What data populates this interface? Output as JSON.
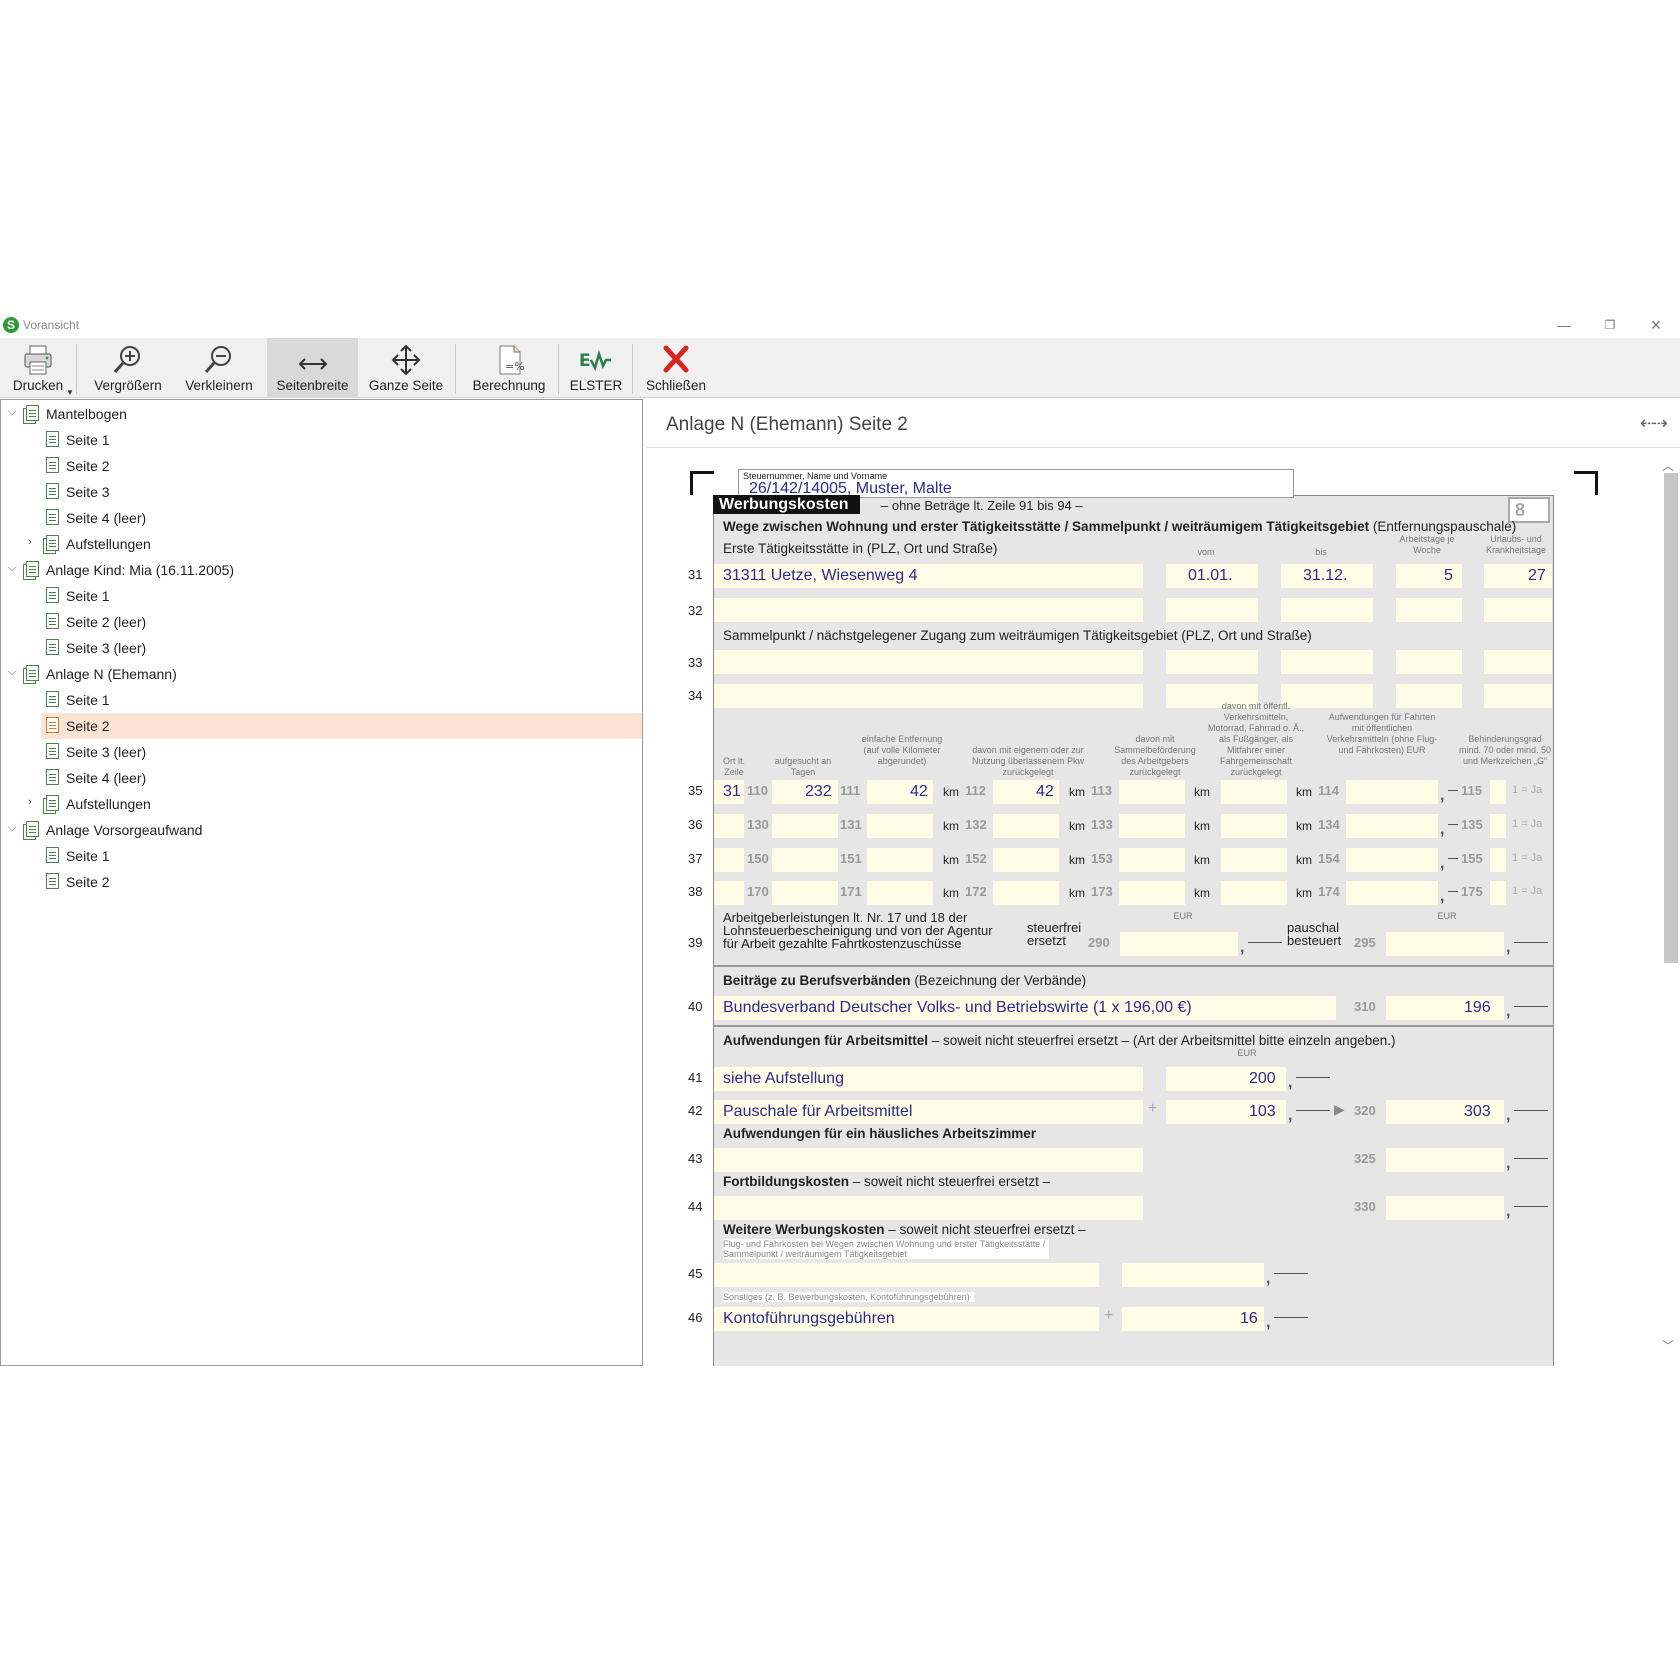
{
  "window": {
    "title": "Voransicht",
    "app_icon": "S"
  },
  "toolbar": {
    "print": "Drucken",
    "zoom_in": "Vergrößern",
    "zoom_out": "Verkleinern",
    "page_width": "Seitenbreite",
    "whole_page": "Ganze Seite",
    "calculation": "Berechnung",
    "elster": "ELSTER",
    "close": "Schließen"
  },
  "tree": {
    "mantelbogen": "Mantelbogen",
    "mb_s1": "Seite 1",
    "mb_s2": "Seite 2",
    "mb_s3": "Seite 3",
    "mb_s4": "Seite 4 (leer)",
    "mb_auf": "Aufstellungen",
    "kind": "Anlage Kind: Mia (16.11.2005)",
    "k_s1": "Seite 1",
    "k_s2": "Seite 2 (leer)",
    "k_s3": "Seite 3 (leer)",
    "anlage_n": "Anlage N (Ehemann)",
    "n_s1": "Seite 1",
    "n_s2": "Seite 2",
    "n_s3": "Seite 3 (leer)",
    "n_s4": "Seite 4 (leer)",
    "n_auf": "Aufstellungen",
    "vorsorge": "Anlage Vorsorgeaufwand",
    "v_s1": "Seite 1",
    "v_s2": "Seite 2"
  },
  "preview": {
    "title": "Anlage N (Ehemann) Seite 2",
    "nav_arrows": "⇠⇢"
  },
  "form": {
    "hdr_label": "Steuernummer, Name und Vorname",
    "hdr_value": "26/142/14005, Muster, Malte",
    "section_title": "Werbungskosten",
    "section_sub": "– ohne Beträge lt. Zeile 91 bis 94 –",
    "page_no": "8",
    "wege_bold": "Wege zwischen Wohnung und erster Tätigkeitsstätte / Sammelpunkt / weiträumigem Tätigkeitsgebiet",
    "wege_rest": " (Entfernungspauschale)",
    "erste": "Erste Tätigkeitsstätte in (PLZ, Ort und Straße)",
    "vom": "vom",
    "bis": "bis",
    "arbeitstage": "Arbeitstage je Woche",
    "urlaub": "Urlaubs- und Krankheitstage",
    "r31": {
      "no": "31",
      "addr": "31311 Uetze, Wiesenweg 4",
      "vom": "01.01.",
      "bis": "31.12.",
      "tage": "5",
      "urlaub": "27"
    },
    "r32": "32",
    "sammel": "Sammelpunkt / nächstgelegener Zugang zum weiträumigen Tätigkeitsgebiet (PLZ, Ort und Straße)",
    "r33": "33",
    "r34": "34",
    "col_ort": "Ort lt. Zeile",
    "col_aufg": "aufgesucht an Tagen",
    "col_einf": "einfache Entfernung (auf volle Kilometer abgerundet)",
    "col_pkw": "davon mit eigenem oder zur Nutzung überlassenem Pkw zurückgelegt",
    "col_sammel": "davon mit Sammelbeförderung des Arbeitgebers zurückgelegt",
    "col_oeff": "davon mit öffentl. Verkehrsmitteln, Motorrad, Fahrrad o. Ä., als Fußgänger, als Mitfahrer einer Fahrgemeinschaft zurückgelegt",
    "col_aufw": "Aufwendungen für Fahrten mit öffentlichen Verkehrsmitteln (ohne Flug- und Fährkosten) EUR",
    "col_beh": "Behinderungsgrad mind. 70 oder mind. 50 und Merkzeichen „G“",
    "km": "km",
    "ja": "1 = Ja",
    "r35": {
      "no": "35",
      "ort": "31",
      "c1": "110",
      "tage": "232",
      "c2": "111",
      "einf": "42",
      "c3": "112",
      "pkw": "42",
      "c4": "113",
      "c5": "114",
      "c6": "115"
    },
    "r36": {
      "no": "36",
      "c1": "130",
      "c2": "131",
      "c3": "132",
      "c4": "133",
      "c5": "134",
      "c6": "135"
    },
    "r37": {
      "no": "37",
      "c1": "150",
      "c2": "151",
      "c3": "152",
      "c4": "153",
      "c5": "154",
      "c6": "155"
    },
    "r38": {
      "no": "38",
      "c1": "170",
      "c2": "171",
      "c3": "172",
      "c4": "173",
      "c5": "174",
      "c6": "175"
    },
    "eur": "EUR",
    "r39": {
      "no": "39",
      "text1": "Arbeitgeberleistungen lt. Nr. 17 und 18 der",
      "text2": "Lohnsteuerbescheinigung und von der Agentur",
      "text3": "für Arbeit gezahlte Fahrtkostenzuschüsse",
      "steuerfrei1": "steuerfrei",
      "steuerfrei2": "ersetzt",
      "c1": "290",
      "pauschal1": "pauschal",
      "pauschal2": "besteuert",
      "c2": "295"
    },
    "beitraege_bold": "Beiträge zu Berufsverbänden",
    "beitraege_rest": " (Bezeichnung der Verbände)",
    "r40": {
      "no": "40",
      "text": "Bundesverband Deutscher Volks- und Betriebswirte (1 x 196,00 €)",
      "code": "310",
      "val": "196"
    },
    "arbeitsmittel_bold": "Aufwendungen für Arbeitsmittel",
    "arbeitsmittel_rest": " – soweit nicht steuerfrei ersetzt – (Art der Arbeitsmittel bitte einzeln angeben.)",
    "r41": {
      "no": "41",
      "text": "siehe Aufstellung",
      "val": "200"
    },
    "r42": {
      "no": "42",
      "text": "Pauschale für Arbeitsmittel",
      "plus": "+",
      "val": "103",
      "code": "320",
      "sum": "303"
    },
    "arbeitszimmer": "Aufwendungen für ein häusliches Arbeitszimmer",
    "r43": {
      "no": "43",
      "code": "325"
    },
    "fortbildung_bold": "Fortbildungskosten",
    "fortbildung_rest": " – soweit nicht steuerfrei ersetzt –",
    "r44": {
      "no": "44",
      "code": "330"
    },
    "weitere_bold": "Weitere Werbungskosten",
    "weitere_rest": " – soweit nicht steuerfrei ersetzt –",
    "flug1": "Flug- und Fährkosten bei Wegen zwischen Wohnung und erster Tätigkeitsstätte /",
    "flug2": "Sammelpunkt / weiträumigem Tätigkeitsgebiet",
    "r45": {
      "no": "45"
    },
    "sonstiges": "Sonstiges (z. B. Bewerbungskosten, Kontoführungsgebühren)",
    "r46": {
      "no": "46",
      "text": "Kontoführungsgebühren",
      "plus": "+",
      "val": "16"
    }
  }
}
